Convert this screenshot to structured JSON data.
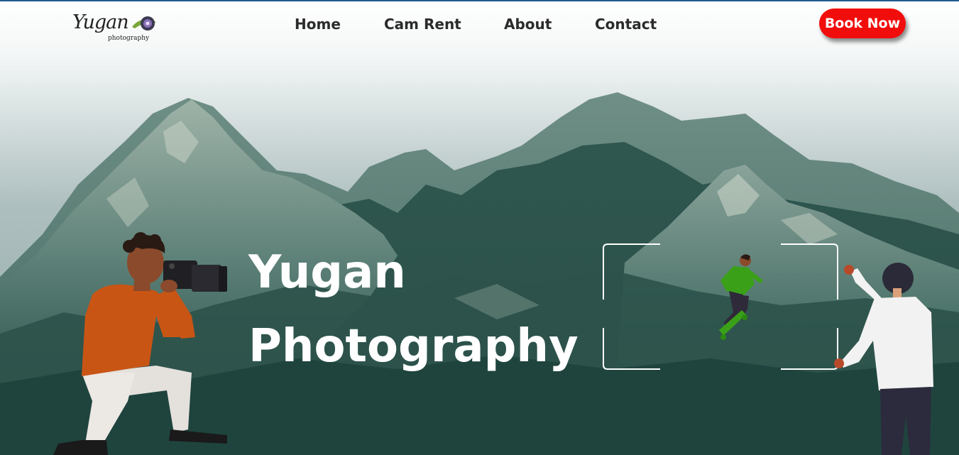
{
  "brand": {
    "logo_text": "Yugan",
    "logo_subtext": "photography"
  },
  "nav": {
    "items": [
      {
        "label": "Home"
      },
      {
        "label": "Cam Rent"
      },
      {
        "label": "About"
      },
      {
        "label": "Contact"
      }
    ],
    "cta_label": "Book Now"
  },
  "hero": {
    "title_line1": "Yugan",
    "title_line2": "Photography"
  },
  "colors": {
    "cta_background": "#f20d0d",
    "nav_text": "#2b2b2b",
    "hero_text": "#ffffff",
    "mountain_dark": "#2f5a52",
    "sky_top": "#ffffff",
    "sky_bottom": "#b9c8c8"
  },
  "icons": [
    "camera-lens-logo-icon"
  ]
}
